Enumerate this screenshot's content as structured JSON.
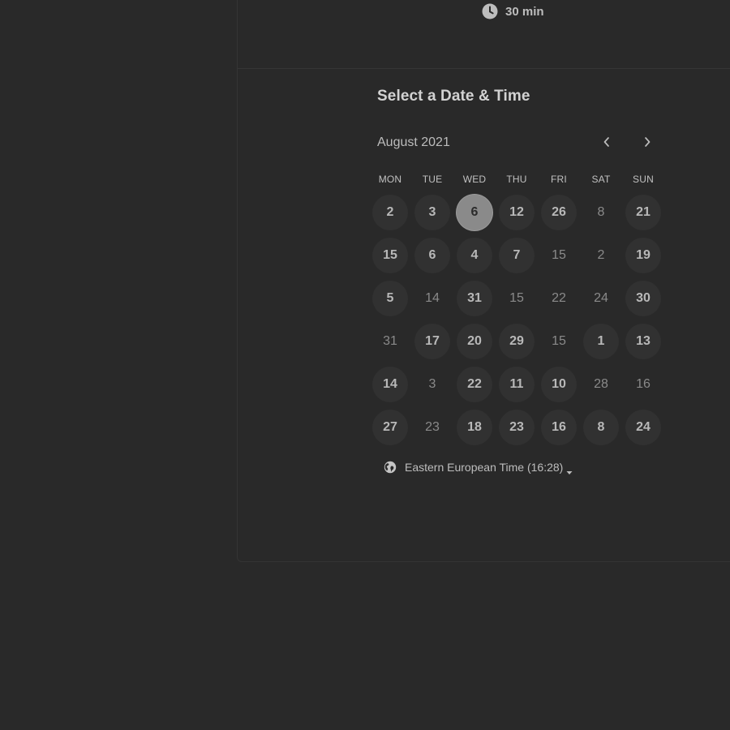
{
  "event": {
    "duration": "30 min",
    "duration_icon": "clock-icon"
  },
  "scheduler": {
    "title": "Select a Date & Time",
    "month": "August 2021",
    "prev_icon": "chevron-left-icon",
    "next_icon": "chevron-right-icon",
    "weekdays": [
      "MON",
      "TUE",
      "WED",
      "THU",
      "FRI",
      "SAT",
      "SUN"
    ],
    "weeks": [
      [
        {
          "label": "2",
          "state": "available"
        },
        {
          "label": "3",
          "state": "available"
        },
        {
          "label": "6",
          "state": "selected"
        },
        {
          "label": "12",
          "state": "available"
        },
        {
          "label": "26",
          "state": "available"
        },
        {
          "label": "8",
          "state": "unavailable"
        },
        {
          "label": "21",
          "state": "available"
        }
      ],
      [
        {
          "label": "15",
          "state": "available"
        },
        {
          "label": "6",
          "state": "available"
        },
        {
          "label": "4",
          "state": "available"
        },
        {
          "label": "7",
          "state": "available"
        },
        {
          "label": "15",
          "state": "unavailable"
        },
        {
          "label": "2",
          "state": "unavailable"
        },
        {
          "label": "19",
          "state": "available"
        }
      ],
      [
        {
          "label": "5",
          "state": "available"
        },
        {
          "label": "14",
          "state": "unavailable"
        },
        {
          "label": "31",
          "state": "available"
        },
        {
          "label": "15",
          "state": "unavailable"
        },
        {
          "label": "22",
          "state": "unavailable"
        },
        {
          "label": "24",
          "state": "unavailable"
        },
        {
          "label": "30",
          "state": "available"
        }
      ],
      [
        {
          "label": "31",
          "state": "unavailable"
        },
        {
          "label": "17",
          "state": "available"
        },
        {
          "label": "20",
          "state": "available"
        },
        {
          "label": "29",
          "state": "available"
        },
        {
          "label": "15",
          "state": "unavailable"
        },
        {
          "label": "1",
          "state": "available"
        },
        {
          "label": "13",
          "state": "available"
        }
      ],
      [
        {
          "label": "14",
          "state": "available"
        },
        {
          "label": "3",
          "state": "unavailable"
        },
        {
          "label": "22",
          "state": "available"
        },
        {
          "label": "11",
          "state": "available"
        },
        {
          "label": "10",
          "state": "available"
        },
        {
          "label": "28",
          "state": "unavailable"
        },
        {
          "label": "16",
          "state": "unavailable"
        }
      ],
      [
        {
          "label": "27",
          "state": "available"
        },
        {
          "label": "23",
          "state": "unavailable"
        },
        {
          "label": "18",
          "state": "available"
        },
        {
          "label": "23",
          "state": "available"
        },
        {
          "label": "16",
          "state": "available"
        },
        {
          "label": "8",
          "state": "available"
        },
        {
          "label": "24",
          "state": "available"
        }
      ]
    ],
    "timezone": {
      "label": "Eastern European Time (16:28)",
      "icon": "globe-icon",
      "dropdown_icon": "caret-down-icon"
    }
  }
}
